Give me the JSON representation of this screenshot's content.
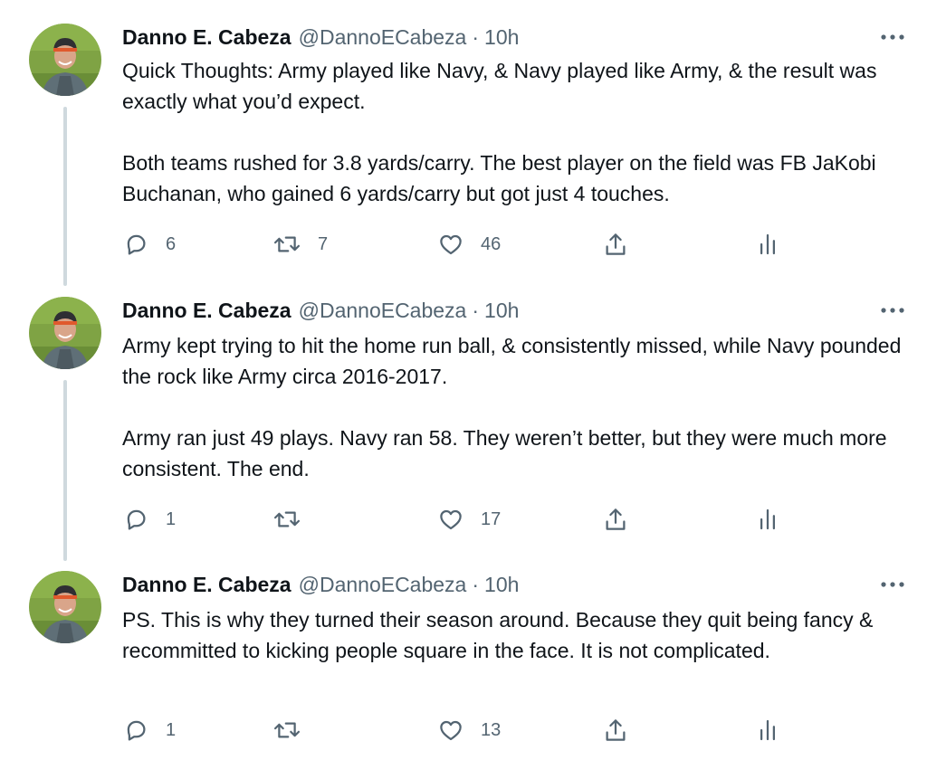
{
  "colors": {
    "text": "#0f1419",
    "muted": "#536471",
    "thread_line": "#cfd9de",
    "background": "#ffffff"
  },
  "tweets": [
    {
      "display_name": "Danno E. Cabeza",
      "handle": "@DannoECabeza",
      "separator": "·",
      "time": "10h",
      "paragraphs": [
        "Quick Thoughts: Army played like Navy, & Navy played like Army, & the result was exactly what you’d expect.",
        "Both teams rushed for 3.8 yards/carry. The best player on the field was FB JaKobi Buchanan, who gained 6 yards/carry but got just 4 touches."
      ],
      "replies": "6",
      "retweets": "7",
      "likes": "46"
    },
    {
      "display_name": "Danno E. Cabeza",
      "handle": "@DannoECabeza",
      "separator": "·",
      "time": "10h",
      "paragraphs": [
        "Army kept trying to hit the home run ball, & consistently missed, while Navy pounded the rock like Army circa 2016-2017.",
        "Army ran just 49 plays. Navy ran 58. They weren’t better, but they were much more consistent. The end."
      ],
      "replies": "1",
      "retweets": "",
      "likes": "17"
    },
    {
      "display_name": "Danno E. Cabeza",
      "handle": "@DannoECabeza",
      "separator": "·",
      "time": "10h",
      "paragraphs": [
        "PS. This is why they turned their season around. Because they quit being fancy & recommitted to kicking people square in the face. It is not complicated."
      ],
      "replies": "1",
      "retweets": "",
      "likes": "13"
    }
  ],
  "icons": {
    "avatar": "profile-photo",
    "more": "more-horizontal-icon",
    "reply": "reply-icon",
    "retweet": "retweet-icon",
    "like": "heart-icon",
    "share": "share-icon",
    "analytics": "analytics-icon"
  }
}
